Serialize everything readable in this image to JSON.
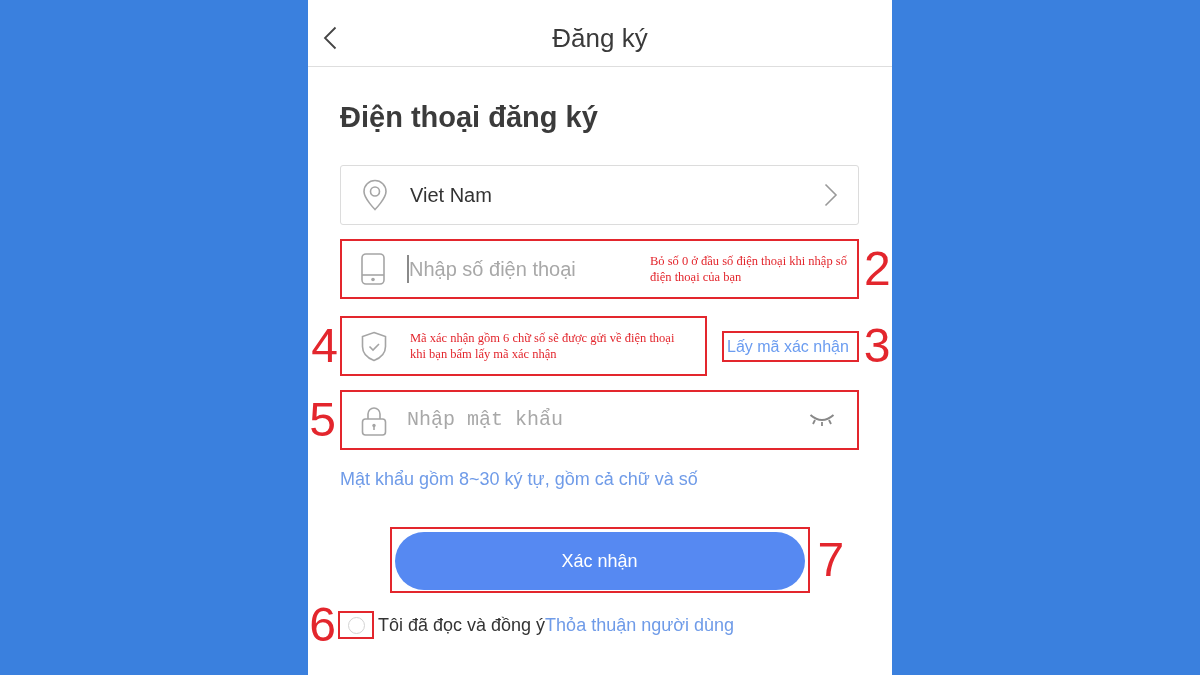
{
  "header": {
    "title": "Đăng ký"
  },
  "heading": "Điện thoại đăng ký",
  "country_field": {
    "value": "Viet Nam"
  },
  "phone_field": {
    "placeholder": "Nhập số điện thoại",
    "focused": true,
    "note": "Bỏ số 0 ở đầu số điện thoại khi nhập số điện thoại của bạn",
    "callout": "2"
  },
  "code_field": {
    "note": "Mã xác nhận gồm 6 chữ số sẽ được gửi về điện thoại khi bạn bấm lấy mã xác nhận",
    "callout": "4"
  },
  "get_code_link": {
    "label": "Lấy mã xác nhận",
    "callout": "3"
  },
  "password_field": {
    "placeholder": "Nhập mật khẩu",
    "visible": false,
    "callout": "5"
  },
  "password_hint": "Mật khẩu gồm 8~30 ký tự, gồm cả chữ và số",
  "submit_button": {
    "label": "Xác nhận",
    "callout": "7"
  },
  "agreement": {
    "checked": false,
    "text": "Tôi đã đọc và đồng ý",
    "link": "Thỏa thuận người dùng",
    "callout": "6"
  }
}
